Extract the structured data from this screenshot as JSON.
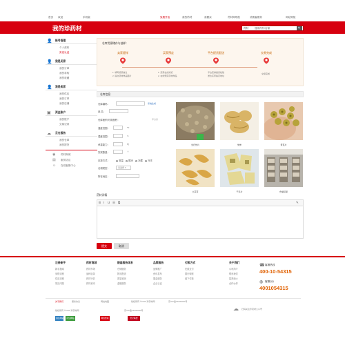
{
  "topbar": {
    "left_links": [
      "首页",
      "欢迎",
      "手机版"
    ],
    "right_links": [
      "免费开店",
      "我的药材",
      "我要买",
      "药材网导航",
      "消费者服务",
      "网站导航"
    ]
  },
  "header": {
    "logo": "我的珍药材",
    "search_select": "药材",
    "search_placeholder": "搜索药材/店铺",
    "search_icon": "🔍"
  },
  "sidebar": {
    "groups": [
      {
        "icon": "person-icon",
        "title": "账号管理",
        "items": [
          "个人资料",
          "实名认证"
        ]
      },
      {
        "icon": "buy-icon",
        "title": "我是买家",
        "items": [
          "我的订单",
          "我的求购",
          "我的收藏"
        ]
      },
      {
        "icon": "sell-icon",
        "title": "我是卖家",
        "items": [
          "我的供应",
          "我的订单",
          "我的店铺"
        ]
      },
      {
        "icon": "wallet-icon",
        "title": "资金账户",
        "items": [
          "我的账户",
          "交易记录"
        ]
      },
      {
        "icon": "cloud-icon",
        "title": "云仓服务",
        "items": [
          "我的仓单",
          "我的提货"
        ]
      }
    ],
    "extra_links": [
      "药材商城",
      "服务协议",
      "在线客服中心"
    ],
    "active_item": "实名认证"
  },
  "steps": {
    "title": "仓库货源储存与抽样：",
    "items": [
      {
        "name": "卖家提样",
        "desc": [
          "1. 填写货源信息",
          "2. 提交药材样品图片"
        ]
      },
      {
        "name": "买家预定",
        "desc": [
          "1. 买家在线浏览",
          "2. 在线预定药材样品"
        ]
      },
      {
        "name": "平台提货配送",
        "desc": [
          "平台安排提货检验",
          "送达买家指定地址"
        ]
      },
      {
        "name": "交易完成",
        "desc": [
          "交易完成"
        ]
      }
    ]
  },
  "form": {
    "head": "仓库信息",
    "fields": [
      {
        "label": "仓库编码：",
        "value": "",
        "hint": "系统生成"
      },
      {
        "label": "品    名：",
        "value": "",
        "hint": ""
      },
      {
        "label": "仓库面积/可用面积：",
        "value": "",
        "hint": "平方米"
      },
      {
        "label": "温度范围：",
        "value": "",
        "hint": "℃"
      },
      {
        "label": "湿度范围：",
        "value": "",
        "hint": "%"
      },
      {
        "label": "承重能力：",
        "value": "",
        "hint": "吨"
      },
      {
        "label": "货架数量：",
        "value": "",
        "hint": "个"
      },
      {
        "label": "存放方式：",
        "value": "",
        "hint": ""
      },
      {
        "label": "仓储类型：",
        "value": "",
        "hint": ""
      },
      {
        "label": "所在地区：",
        "value": "",
        "hint": ""
      },
      {
        "label": "仓库地址：",
        "value": "",
        "hint": ""
      }
    ],
    "radios": [
      "常温",
      "阴凉",
      "冷藏",
      "冷冻"
    ],
    "select_value": "请选择",
    "photo_captions": [
      "当归饮片",
      "党参",
      "黄芪片",
      "土茯苓",
      "干姜片",
      "仓储货架"
    ]
  },
  "editor": {
    "label": "药材详情",
    "tools": [
      "B",
      "I",
      "U",
      "☰",
      "⧉",
      "✎"
    ]
  },
  "buttons": {
    "submit": "提交",
    "cancel": "取消"
  },
  "footer": {
    "columns": [
      {
        "title": "注册新手",
        "items": [
          "新手指南",
          "采购流程",
          "供应流程",
          "常见问题"
        ]
      },
      {
        "title": "药材商城",
        "items": [
          "药材市场",
          "品种目录",
          "药材行情",
          "药材资讯"
        ]
      },
      {
        "title": "配套服务体系",
        "items": [
          "仓储服务",
          "物流配送",
          "质量检测",
          "金融服务"
        ]
      },
      {
        "title": "品牌服务",
        "items": [
          "品牌推广",
          "资讯发布",
          "展会服务",
          "企业认证"
        ]
      },
      {
        "title": "付款方式",
        "items": [
          "在线支付",
          "银行转账",
          "线下付款"
        ]
      },
      {
        "title": "关于我们",
        "items": [
          "公司简介",
          "联系我们",
          "招贤纳士",
          "合作伙伴"
        ]
      }
    ],
    "hotlines": [
      {
        "label": "客服热线",
        "number": "400-10-54315"
      },
      {
        "label": "客服QQ",
        "number": "4001054315"
      }
    ],
    "copyright": [
      "关于我们",
      "服务协议",
      "网站地图",
      "版权所有 ©2016 珍药材网",
      "京ICP备16000000号"
    ],
    "badges": [
      "诚信网站",
      "可信网站",
      "网络警察",
      "安全联盟"
    ],
    "mobile_text": "扫码关注珍药材公众号"
  }
}
